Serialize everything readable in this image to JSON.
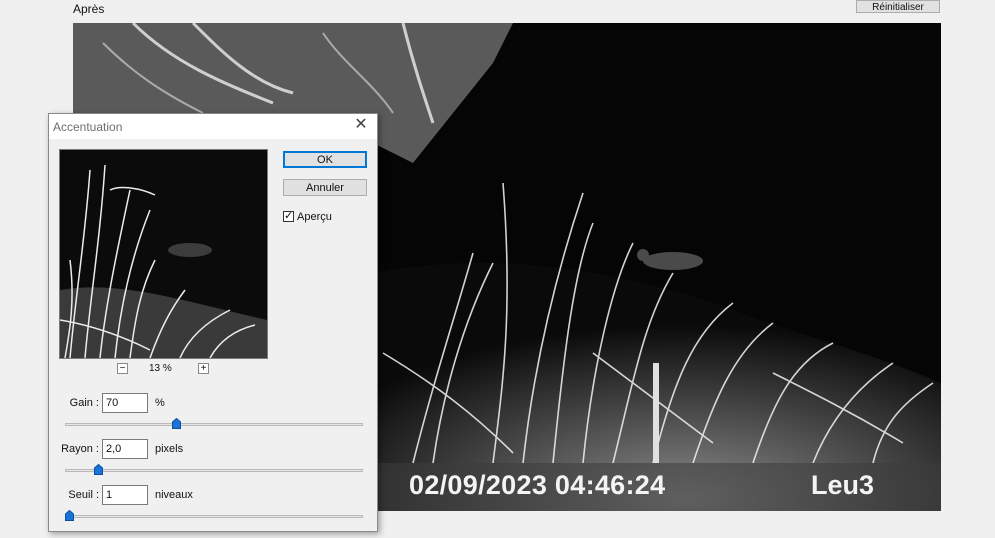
{
  "header": {
    "after_label": "Après",
    "reset_label": "Réinitialiser"
  },
  "photo": {
    "timestamp": "02/09/2023 04:46:24",
    "camera": "Leu3"
  },
  "dialog": {
    "title": "Accentuation",
    "ok_label": "OK",
    "cancel_label": "Annuler",
    "preview_label": "Aperçu",
    "preview_checked": true,
    "zoom_minus": "−",
    "zoom_plus": "+",
    "zoom_level": "13 %",
    "gain": {
      "label": "Gain :",
      "value": "70",
      "unit": "%",
      "slider_fraction": 0.37
    },
    "radius": {
      "label": "Rayon :",
      "value": "2,0",
      "unit": "pixels",
      "slider_fraction": 0.1
    },
    "threshold": {
      "label": "Seuil :",
      "value": "1",
      "unit": "niveaux",
      "slider_fraction": 0.0
    }
  },
  "colors": {
    "accent": "#0078d7",
    "dialog_bg": "#f0f0f0"
  }
}
